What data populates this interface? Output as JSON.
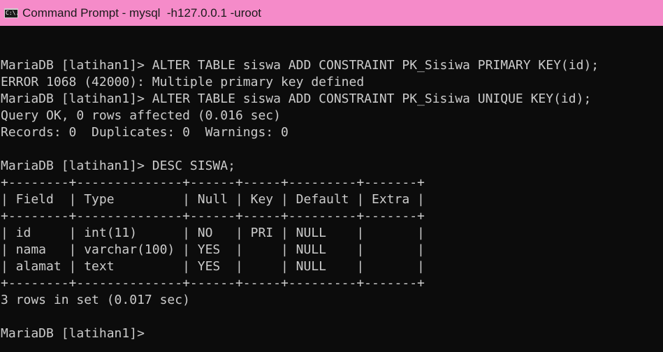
{
  "window": {
    "title": "Command Prompt - mysql  -h127.0.0.1 -uroot",
    "icon": "cmd-icon",
    "icon_text": "C:\\.",
    "titlebar_color": "#f58bc9",
    "background_color": "#0c0c0c",
    "text_color": "#cccccc"
  },
  "console": {
    "lines": [
      "",
      "MariaDB [latihan1]> ALTER TABLE siswa ADD CONSTRAINT PK_Sisiwa PRIMARY KEY(id);",
      "ERROR 1068 (42000): Multiple primary key defined",
      "MariaDB [latihan1]> ALTER TABLE siswa ADD CONSTRAINT PK_Sisiwa UNIQUE KEY(id);",
      "Query OK, 0 rows affected (0.016 sec)",
      "Records: 0  Duplicates: 0  Warnings: 0",
      "",
      "MariaDB [latihan1]> DESC SISWA;",
      "+--------+--------------+------+-----+---------+-------+",
      "| Field  | Type         | Null | Key | Default | Extra |",
      "+--------+--------------+------+-----+---------+-------+",
      "| id     | int(11)      | NO   | PRI | NULL    |       |",
      "| nama   | varchar(100) | YES  |     | NULL    |       |",
      "| alamat | text         | YES  |     | NULL    |       |",
      "+--------+--------------+------+-----+---------+-------+",
      "3 rows in set (0.017 sec)",
      "",
      "MariaDB [latihan1]> "
    ]
  }
}
